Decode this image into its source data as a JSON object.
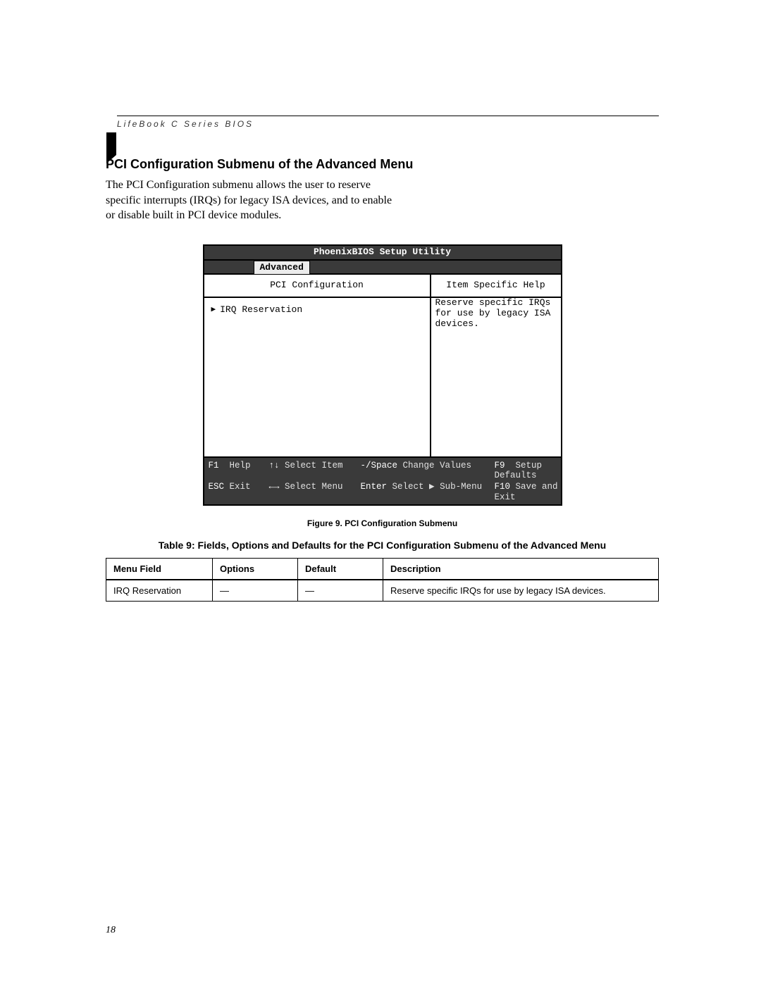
{
  "header": {
    "book": "LifeBook C Series BIOS"
  },
  "section": {
    "title": "PCI Configuration Submenu of the Advanced Menu",
    "body": "The PCI Configuration submenu allows the user to reserve specific interrupts (IRQs) for legacy ISA devices, and to enable or disable built in PCI device modules."
  },
  "bios": {
    "title": "PhoenixBIOS Setup Utility",
    "active_tab": "Advanced",
    "left_heading": "PCI Configuration",
    "right_heading": "Item Specific Help",
    "items": [
      {
        "label": "IRQ Reservation"
      }
    ],
    "help_text": "Reserve specific IRQs for use by legacy ISA devices.",
    "footer": {
      "r1c1_key": "F1",
      "r1c1_lbl": "Help",
      "r1c2_key": "↑↓",
      "r1c2_lbl": "Select Item",
      "r1c3_key": "-/Space",
      "r1c3_lbl": "Change Values",
      "r1c4_key": "F9",
      "r1c4_lbl": "Setup Defaults",
      "r2c1_key": "ESC",
      "r2c1_lbl": "Exit",
      "r2c2_key": "←→",
      "r2c2_lbl": "Select Menu",
      "r2c3_key": "Enter",
      "r2c3_lbl": "Select ▶ Sub-Menu",
      "r2c4_key": "F10",
      "r2c4_lbl": "Save and Exit"
    }
  },
  "figure": {
    "caption": "Figure 9.  PCI Configuration Submenu"
  },
  "table": {
    "caption": "Table 9: Fields, Options and Defaults for  the PCI Configuration Submenu of the Advanced Menu",
    "headers": [
      "Menu Field",
      "Options",
      "Default",
      "Description"
    ],
    "rows": [
      {
        "menu_field": "IRQ Reservation",
        "options": "—",
        "default": "—",
        "description": "Reserve specific IRQs for use by legacy ISA devices."
      }
    ]
  },
  "page_number": "18"
}
